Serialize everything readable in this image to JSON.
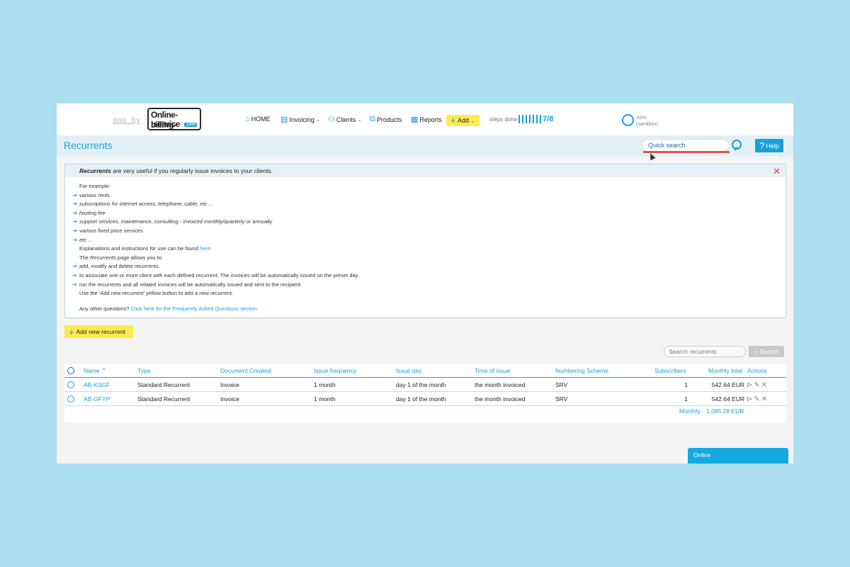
{
  "topbar": {
    "app_by": "app_by",
    "logo": {
      "line1": "Online-billing-",
      "line2": "service",
      "badge": ".com"
    },
    "nav": [
      {
        "label": "HOME",
        "icon": "home-icon"
      },
      {
        "label": "Invoicing",
        "icon": "invoice-icon"
      },
      {
        "label": "Clients",
        "icon": "clients-icon"
      },
      {
        "label": "Products",
        "icon": "products-icon"
      },
      {
        "label": "Reports",
        "icon": "reports-icon"
      }
    ],
    "add_label": "Add",
    "steps_label": "steps done",
    "steps_count": "7/8",
    "user": {
      "name": "John",
      "sub": "(sandbox)"
    }
  },
  "header": {
    "title": "Recurrents",
    "quick_search_value": "Quick search",
    "help_label": "Help"
  },
  "info": {
    "head_em": "Recurrents",
    "head_rest": " are very useful if you regularly issue invoices to your clients.",
    "for_example": "For example:",
    "examples": [
      "various rents",
      "subscriptions for internet access, telephone, cable, etc ...",
      "hosting fee",
      "support services, maintenance, consulting - invoiced monthly/quarterly or annually",
      "various fixed price services",
      "etc ..."
    ],
    "explanations_pre": "Explanations and instructions for use can be found ",
    "explanations_link": "here",
    "explanations_post": ".",
    "page_allows_pre": "The ",
    "page_allows_em": "Recurrents",
    "page_allows_post": " page allows you to:",
    "actions": [
      "add, modify and delete recurrents.",
      "to associate one or more client with each defined recurrent. The invoices will be automatically issued on the preset day.",
      "run the recurrents and all related invoices will be automatically issued and sent to the recipient"
    ],
    "use_add": "Use the 'Add new recurrent' yellow button to add a new recurrent.",
    "questions_pre": "Any other questions? ",
    "questions_link": "Click here for the Frequently Asked Questions section."
  },
  "add_new_label": "Add new recurrent",
  "search": {
    "placeholder": "Search recurrents",
    "button": "Search"
  },
  "table": {
    "headers": {
      "name": "Name",
      "type": "Type",
      "document": "Document Created",
      "frequency": "Issue frequency",
      "day": "Issue day",
      "time": "Time of issue",
      "scheme": "Numbering Scheme",
      "subscribers": "Subscribers",
      "monthly": "Monthly total",
      "actions": "Actions"
    },
    "rows": [
      {
        "name": "AB-KSGF",
        "type": "Standard Recurrent",
        "document": "Invoice",
        "frequency": "1 month",
        "day": "day 1 of the month",
        "time": "the month invoiced",
        "scheme": "SRV",
        "subscribers": "1",
        "monthly": "542.64 EUR"
      },
      {
        "name": "AB-GFYP",
        "type": "Standard Recurrent",
        "document": "Invoice",
        "frequency": "1 month",
        "day": "day 1 of the month",
        "time": "the month invoiced",
        "scheme": "SRV",
        "subscribers": "1",
        "monthly": "542.64 EUR"
      }
    ],
    "total_label": "Monthly",
    "total_value": "1,085.28 EUR"
  },
  "online_label": "Online",
  "colors": {
    "accent": "#1a9fd6",
    "yellow": "#ffe94d",
    "close": "#e03a3a",
    "background": "#acdef1"
  }
}
